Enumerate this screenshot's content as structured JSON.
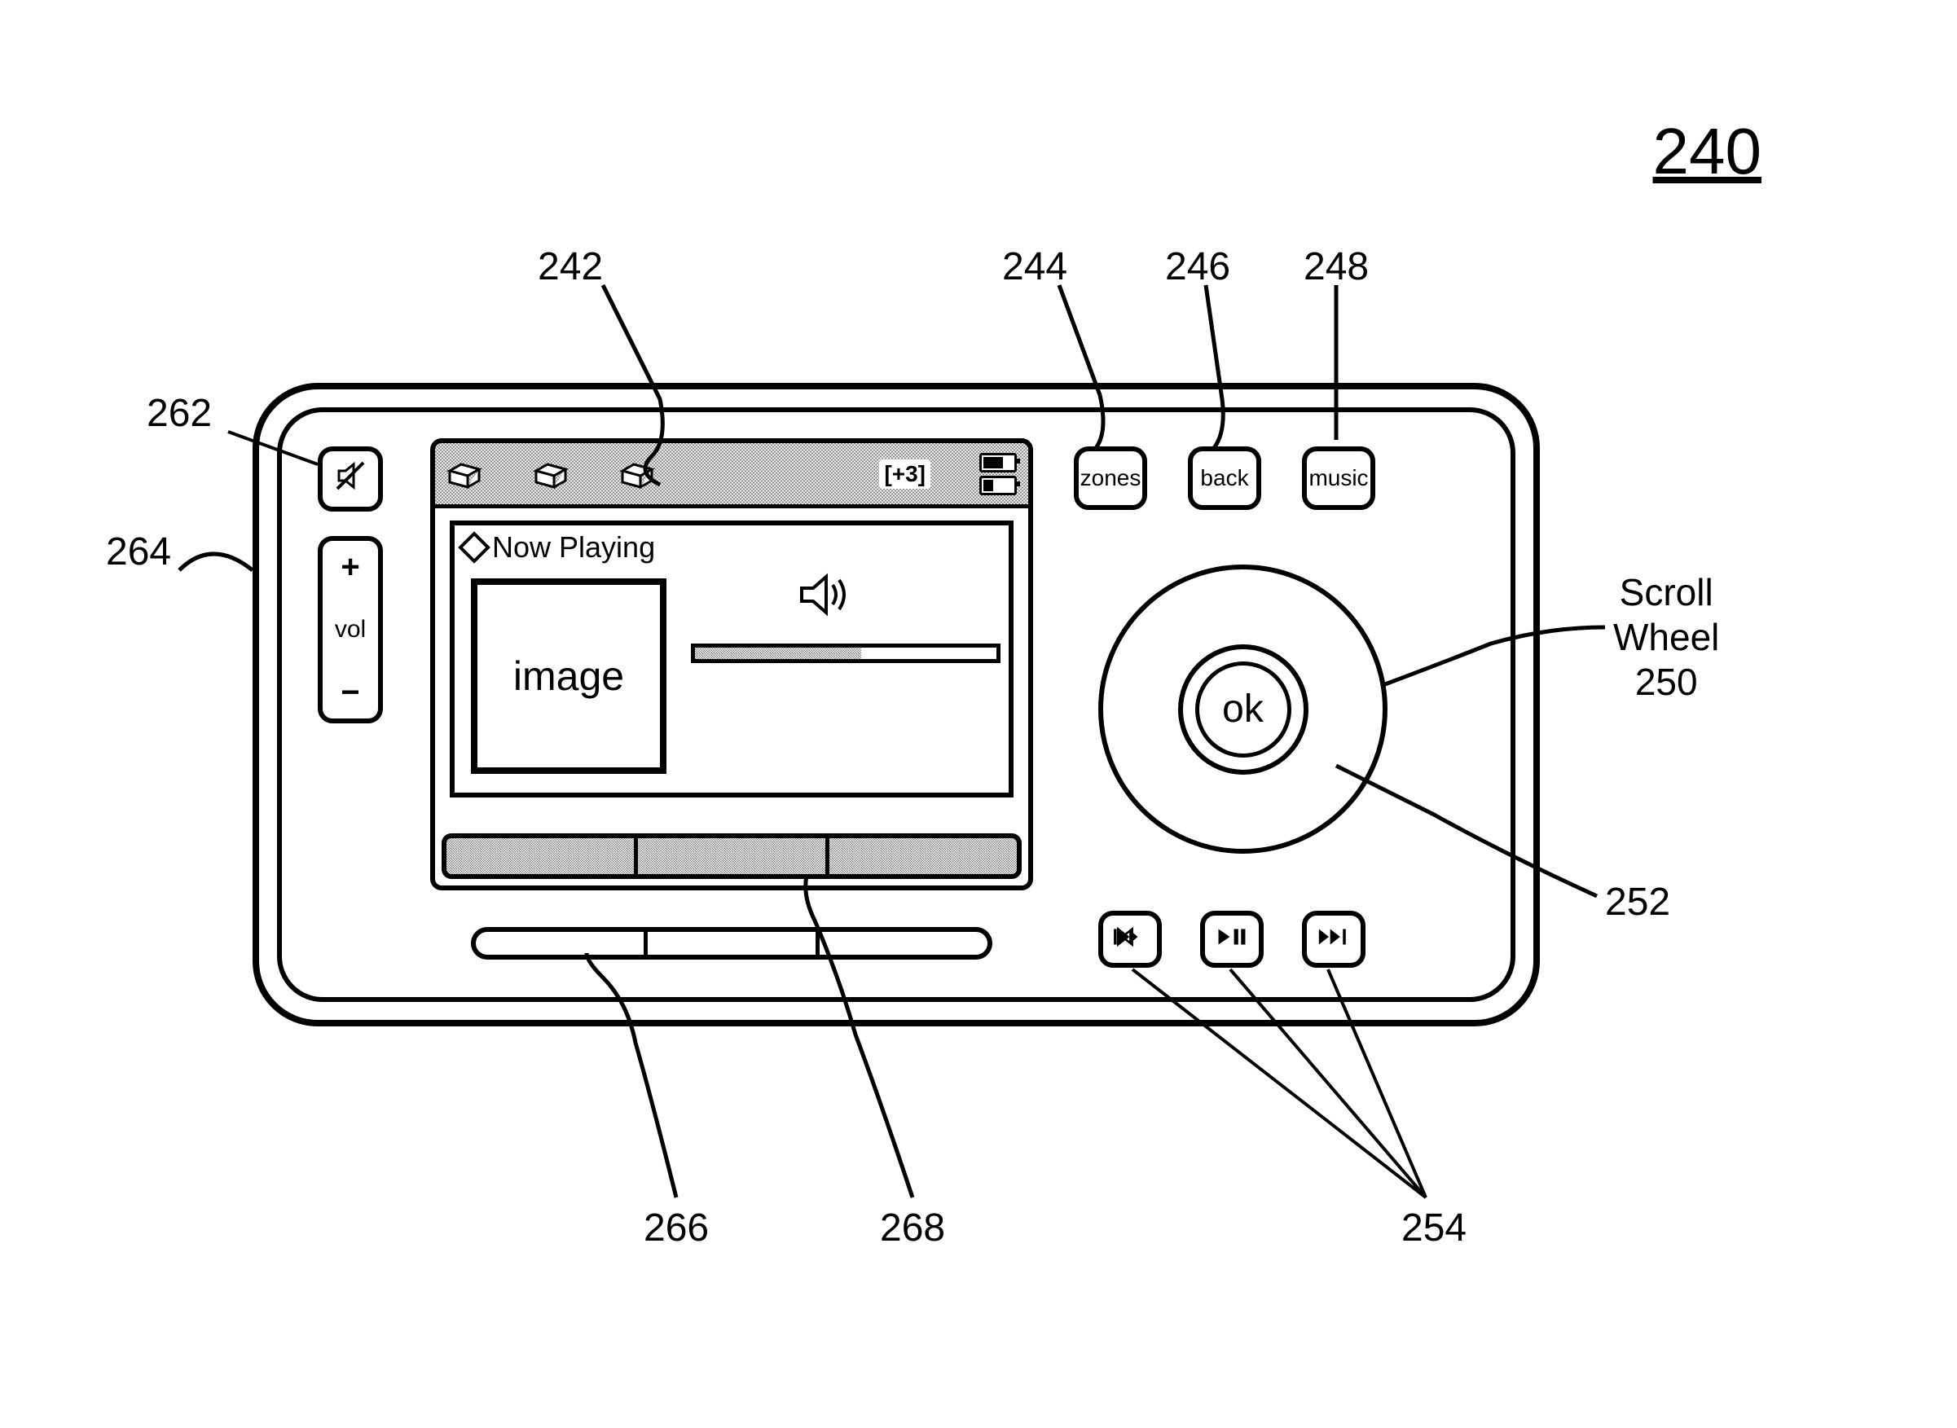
{
  "figure_number": "240",
  "labels": {
    "r242": "242",
    "r244": "244",
    "r246": "246",
    "r248": "248",
    "r250_line1": "Scroll",
    "r250_line2": "Wheel",
    "r250_line3": "250",
    "r252": "252",
    "r254": "254",
    "r262": "262",
    "r264": "264",
    "r266": "266",
    "r268": "268"
  },
  "buttons": {
    "zones": "zones",
    "back": "back",
    "music": "music",
    "ok": "ok",
    "vol_label": "vol",
    "vol_plus": "+",
    "vol_minus": "−"
  },
  "screen": {
    "now_playing_title": "Now Playing",
    "album_placeholder": "image",
    "titlebar_counter": "[+3]",
    "battery_top_fill_pct": 60,
    "battery_bottom_fill_pct": 30,
    "progress_pct": 55
  },
  "icons": {
    "mute": "mute-icon",
    "prev": "skip-back-icon",
    "play": "play-pause-icon",
    "next": "skip-forward-icon",
    "speaker": "speaker-icon",
    "zone": "zone-box-icon"
  }
}
